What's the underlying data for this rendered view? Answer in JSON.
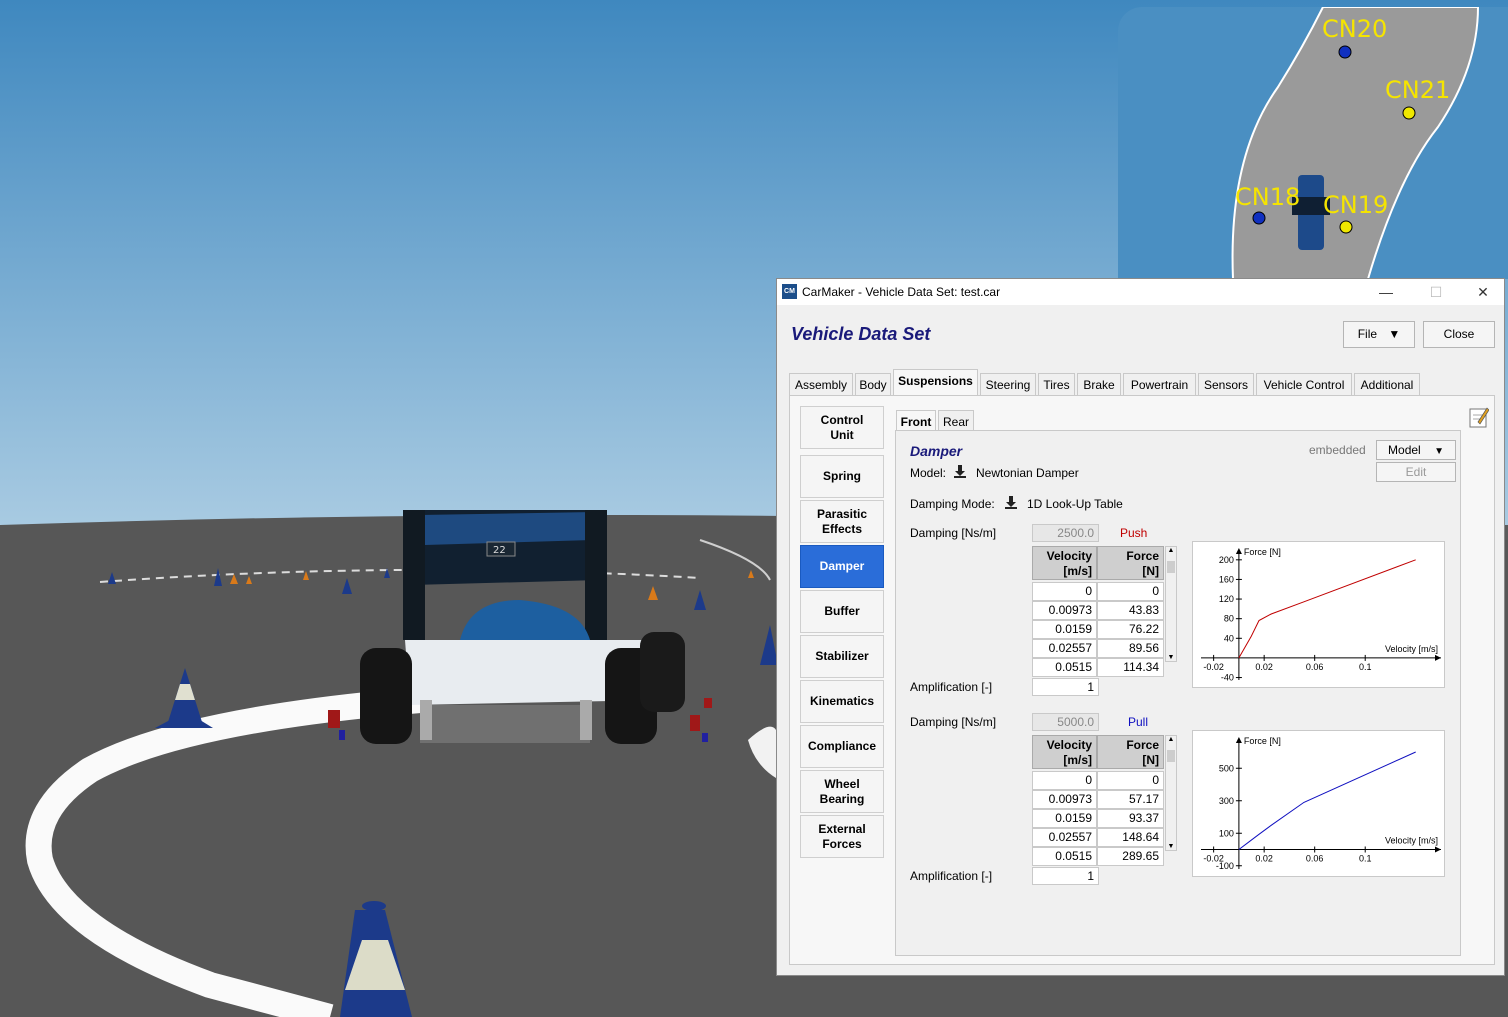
{
  "minimap": {
    "points": [
      {
        "label": "CN20",
        "color": "#1030c0"
      },
      {
        "label": "CN21",
        "color": "#f0e800"
      },
      {
        "label": "CN18",
        "color": "#1030c0"
      },
      {
        "label": "CN19",
        "color": "#f0e800"
      }
    ]
  },
  "car": {
    "number": "22"
  },
  "window": {
    "title": "CarMaker - Vehicle Data Set: test.car",
    "logo": "CM",
    "heading": "Vehicle Data Set",
    "file_label": "File",
    "close_label": "Close",
    "controls": {
      "minimize": "—",
      "maximize": "☐",
      "close": "✕"
    }
  },
  "tabs": [
    "Assembly",
    "Body",
    "Suspensions",
    "Steering",
    "Tires",
    "Brake",
    "Powertrain",
    "Sensors",
    "Vehicle Control",
    "Additional"
  ],
  "sidebar": [
    {
      "label": "Control\nUnit"
    },
    {
      "label": "Spring"
    },
    {
      "label": "Parasitic\nEffects"
    },
    {
      "label": "Damper"
    },
    {
      "label": "Buffer"
    },
    {
      "label": "Stabilizer"
    },
    {
      "label": "Kinematics"
    },
    {
      "label": "Compliance"
    },
    {
      "label": "Wheel\nBearing"
    },
    {
      "label": "External\nForces"
    }
  ],
  "subtabs": [
    "Front",
    "Rear"
  ],
  "damper": {
    "title": "Damper",
    "embedded": "embedded",
    "model_btn": "Model",
    "edit_btn": "Edit",
    "model_label": "Model:",
    "model_value": "Newtonian Damper",
    "mode_label": "Damping Mode:",
    "mode_value": "1D Look-Up Table",
    "push": {
      "damping_label": "Damping [Ns/m]",
      "damping_value": "2500.0",
      "direction": "Push",
      "amp_label": "Amplification [-]",
      "amp_value": "1",
      "headers": [
        "Velocity\n[m/s]",
        "Force\n[N]"
      ],
      "rows": [
        [
          "0",
          "0"
        ],
        [
          "0.00973",
          "43.83"
        ],
        [
          "0.0159",
          "76.22"
        ],
        [
          "0.02557",
          "89.56"
        ],
        [
          "0.0515",
          "114.34"
        ]
      ]
    },
    "pull": {
      "damping_label": "Damping [Ns/m]",
      "damping_value": "5000.0",
      "direction": "Pull",
      "amp_label": "Amplification [-]",
      "amp_value": "1",
      "headers": [
        "Velocity\n[m/s]",
        "Force\n[N]"
      ],
      "rows": [
        [
          "0",
          "0"
        ],
        [
          "0.00973",
          "57.17"
        ],
        [
          "0.0159",
          "93.37"
        ],
        [
          "0.02557",
          "148.64"
        ],
        [
          "0.0515",
          "289.65"
        ]
      ]
    }
  },
  "chart_data": [
    {
      "type": "line",
      "ylabel": "Force [N]",
      "xlabel": "Velocity [m/s]",
      "xticks": [
        "-0.02",
        "0.02",
        "0.06",
        "0.1"
      ],
      "yticks": [
        "-40",
        "40",
        "80",
        "120",
        "160",
        "200"
      ],
      "series": [
        {
          "color": "#c00000",
          "x": [
            0,
            0.00973,
            0.0159,
            0.02557,
            0.0515,
            0.14
          ],
          "y": [
            0,
            43.83,
            76.22,
            89.56,
            114.34,
            200
          ]
        }
      ]
    },
    {
      "type": "line",
      "ylabel": "Force [N]",
      "xlabel": "Velocity [m/s]",
      "xticks": [
        "-0.02",
        "0.02",
        "0.06",
        "0.1"
      ],
      "yticks": [
        "-100",
        "100",
        "300",
        "500"
      ],
      "series": [
        {
          "color": "#1010c0",
          "x": [
            0,
            0.00973,
            0.0159,
            0.02557,
            0.0515,
            0.14
          ],
          "y": [
            0,
            57.17,
            93.37,
            148.64,
            289.65,
            600
          ]
        }
      ]
    }
  ]
}
